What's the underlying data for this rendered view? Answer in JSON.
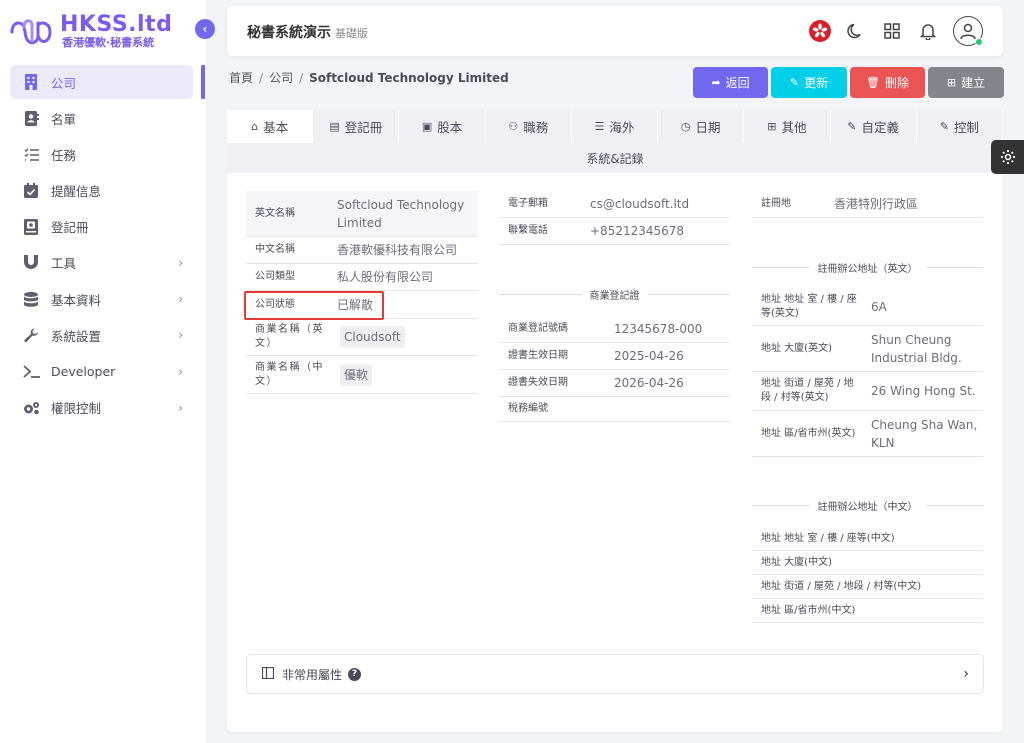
{
  "app": {
    "logo_title": "HKSS.ltd",
    "logo_sub": "香港優軟·秘書系統",
    "header_title": "秘書系統演示",
    "header_edition": "基礎版"
  },
  "sidebar": {
    "items": [
      {
        "label": "公司",
        "icon": "building-icon",
        "active": true,
        "arrow": false
      },
      {
        "label": "名單",
        "icon": "contacts-icon",
        "active": false,
        "arrow": false
      },
      {
        "label": "任務",
        "icon": "list-check-icon",
        "active": false,
        "arrow": false
      },
      {
        "label": "提醒信息",
        "icon": "calendar-check-icon",
        "active": false,
        "arrow": false
      },
      {
        "label": "登記冊",
        "icon": "register-book-icon",
        "active": false,
        "arrow": false
      },
      {
        "label": "工具",
        "icon": "magnet-icon",
        "active": false,
        "arrow": true
      },
      {
        "label": "基本資料",
        "icon": "database-icon",
        "active": false,
        "arrow": true
      },
      {
        "label": "系統設置",
        "icon": "wrench-icon",
        "active": false,
        "arrow": true
      },
      {
        "label": "Developer",
        "icon": "terminal-icon",
        "active": false,
        "arrow": true
      },
      {
        "label": "權限控制",
        "icon": "cogs-icon",
        "active": false,
        "arrow": true
      }
    ]
  },
  "breadcrumb": {
    "home": "首頁",
    "section": "公司",
    "current": "Softcloud Technology Limited"
  },
  "actions": {
    "back": "返回",
    "update": "更新",
    "delete": "刪除",
    "create": "建立"
  },
  "tabs": [
    {
      "label": "基本",
      "icon": "home-icon",
      "active": true
    },
    {
      "label": "登記冊",
      "icon": "document-icon",
      "active": false
    },
    {
      "label": "股本",
      "icon": "money-icon",
      "active": false
    },
    {
      "label": "職務",
      "icon": "users-icon",
      "active": false
    },
    {
      "label": "海外",
      "icon": "server-icon",
      "active": false
    },
    {
      "label": "日期",
      "icon": "clock-icon",
      "active": false
    },
    {
      "label": "其他",
      "icon": "grid-icon",
      "active": false
    },
    {
      "label": "自定義",
      "icon": "user-edit-icon",
      "active": false
    },
    {
      "label": "控制",
      "icon": "user-control-icon",
      "active": false
    }
  ],
  "subtab": "系統&記錄",
  "basic": {
    "en_name_label": "英文名稱",
    "en_name": "Softcloud Technology Limited",
    "zh_name_label": "中文名稱",
    "zh_name": "香港軟優科技有限公司",
    "type_label": "公司類型",
    "type": "私人股份有限公司",
    "status_label": "公司狀態",
    "status": "已解散",
    "biz_en_label": "商業名稱（英文）",
    "biz_en": "Cloudsoft",
    "biz_zh_label": "商業名稱（中文）",
    "biz_zh": "優軟"
  },
  "contact": {
    "email_label": "電子郵箱",
    "email": "cs@cloudsoft.ltd",
    "phone_label": "聯繫電話",
    "phone": "+85212345678"
  },
  "br": {
    "title": "商業登記證",
    "no_label": "商業登記號碼",
    "no": "12345678-000",
    "start_label": "證書生效日期",
    "start": "2025-04-26",
    "end_label": "證書失效日期",
    "end": "2026-04-26",
    "tax_label": "稅務編號",
    "tax": ""
  },
  "reg": {
    "place_label": "註冊地",
    "place": "香港特別行政區",
    "addr_en_title": "註冊辦公地址（英文）",
    "en_room_label": "地址 地址 室 / 樓 / 座等(英文)",
    "en_room": "6A",
    "en_bldg_label": "地址 大廈(英文)",
    "en_bldg": "Shun Cheung Industrial Bldg.",
    "en_street_label": "地址 街道 / 屋苑 / 地段 / 村等(英文)",
    "en_street": "26 Wing Hong St.",
    "en_district_label": "地址 區/省市州(英文)",
    "en_district": "Cheung Sha Wan, KLN",
    "addr_zh_title": "註冊辦公地址（中文）",
    "zh_room_label": "地址 地址 室 / 樓 / 座等(中文)",
    "zh_bldg_label": "地址 大廈(中文)",
    "zh_street_label": "地址 街道 / 屋苑 / 地段 / 村等(中文)",
    "zh_district_label": "地址 區/省市州(中文)"
  },
  "panel": {
    "label": "非常用屬性",
    "help": "?"
  }
}
